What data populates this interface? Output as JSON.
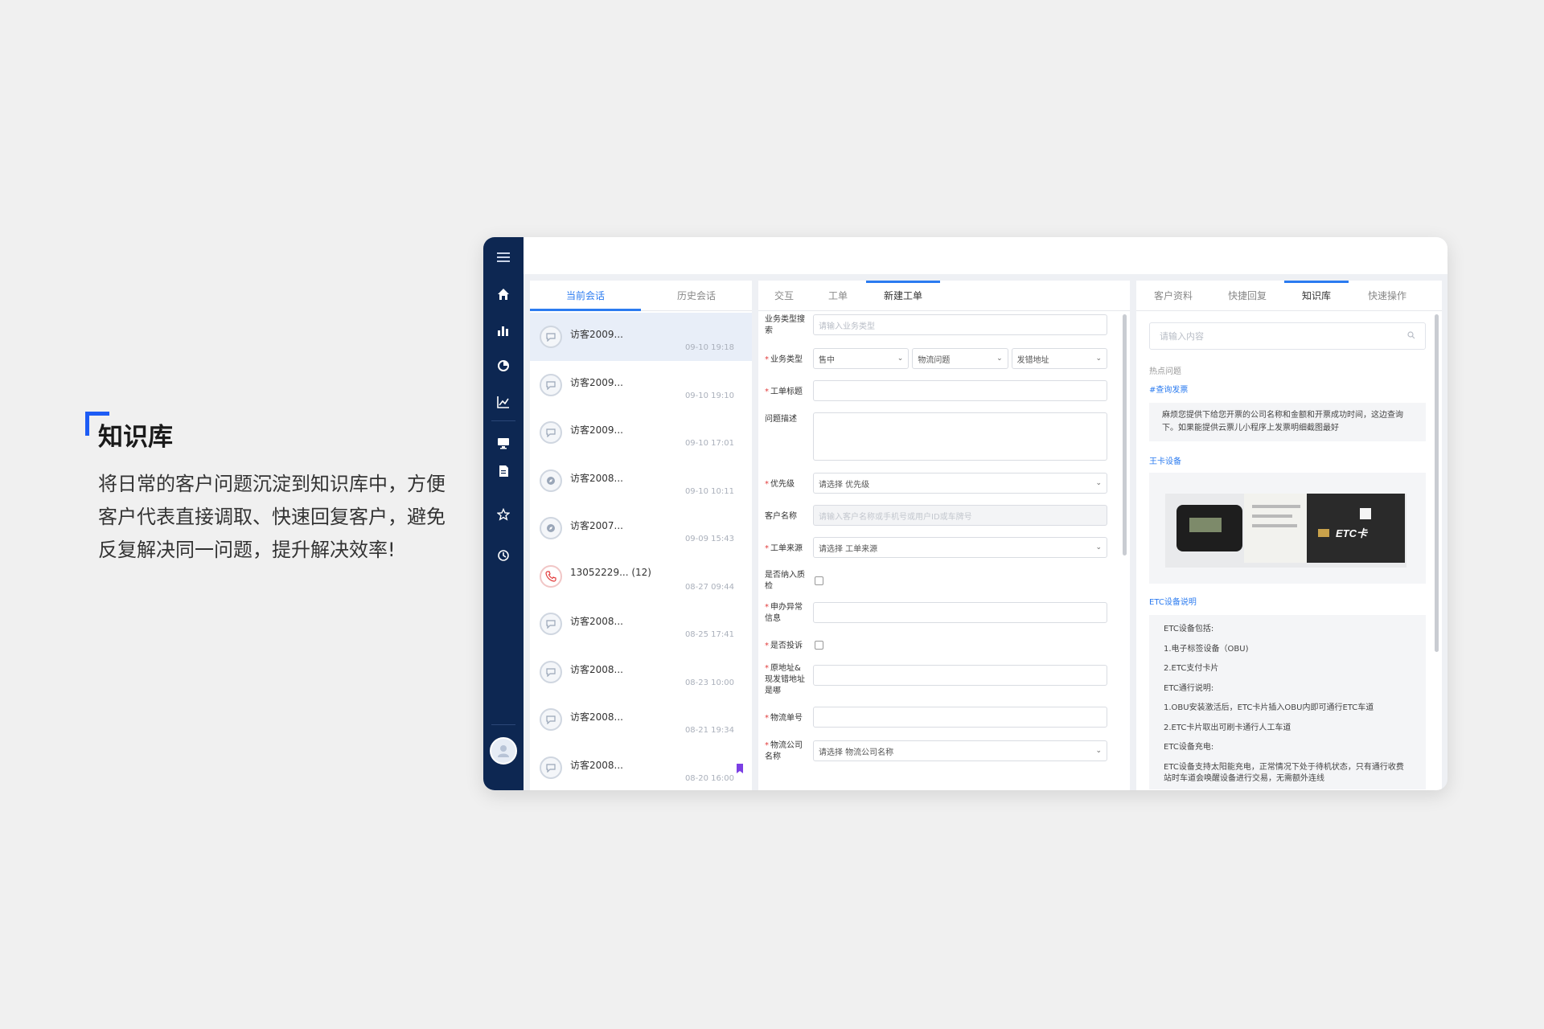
{
  "intro": {
    "title": "知识库",
    "description": "将日常的客户问题沉淀到知识库中，方便客户代表直接调取、快速回复客户，避免反复解决同一问题，提升解决效率!"
  },
  "colors": {
    "accent": "#2b7bf0",
    "rail": "#0d2752",
    "brand_corner": "#1d5cf5",
    "required": "#e23b3b"
  },
  "rail_icons": [
    "menu-icon",
    "home-icon",
    "bar-chart-icon",
    "pie-chart-icon",
    "line-chart-icon",
    "monitor-icon",
    "document-icon",
    "star-icon",
    "history-icon"
  ],
  "conversations": {
    "tabs": [
      "当前会话",
      "历史会话"
    ],
    "items": [
      {
        "name": "访客2009...",
        "time": "09-10 19:18",
        "icon": "chat-icon"
      },
      {
        "name": "访客2009...",
        "time": "09-10 19:10",
        "icon": "chat-icon"
      },
      {
        "name": "访客2009...",
        "time": "09-10 17:01",
        "icon": "chat-icon"
      },
      {
        "name": "访客2008...",
        "time": "09-10 10:11",
        "icon": "compass-icon"
      },
      {
        "name": "访客2007...",
        "time": "09-09 15:43",
        "icon": "compass-icon"
      },
      {
        "name": "13052229...  (12)",
        "time": "08-27 09:44",
        "icon": "phone-icon"
      },
      {
        "name": "访客2008...",
        "time": "08-25 17:41",
        "icon": "chat-icon"
      },
      {
        "name": "访客2008...",
        "time": "08-23 10:00",
        "icon": "chat-icon"
      },
      {
        "name": "访客2008...",
        "time": "08-21 19:34",
        "icon": "chat-icon"
      },
      {
        "name": "访客2008...",
        "time": "08-20 16:00",
        "icon": "chat-icon"
      }
    ]
  },
  "ticket": {
    "tabs": [
      "交互",
      "工单",
      "新建工单"
    ],
    "fields": {
      "biz_search_label": "业务类型搜索",
      "biz_search_placeholder": "请输入业务类型",
      "biz_type_label": "业务类型",
      "biz_type_values": [
        "售中",
        "物流问题",
        "发错地址"
      ],
      "title_label": "工单标题",
      "desc_label": "问题描述",
      "priority_label": "优先级",
      "priority_value": "请选择 优先级",
      "customer_label": "客户名称",
      "customer_placeholder": "请输入客户名称或手机号或用户ID或车牌号",
      "source_label": "工单来源",
      "source_value": "请选择 工单来源",
      "qc_label": "是否纳入质检",
      "exception_label": "申办异常信息",
      "complaint_label": "是否投诉",
      "address_label": "原地址&现发错地址是哪",
      "tracking_label": "物流单号",
      "logistics_label": "物流公司名称",
      "logistics_value": "请选择 物流公司名称"
    }
  },
  "knowledge": {
    "tabs": [
      "客户资料",
      "快捷回复",
      "知识库",
      "快速操作"
    ],
    "search_placeholder": "请输入内容",
    "hot_label": "热点问题",
    "item1_title": "#查询发票",
    "item1_text": "麻烦您提供下给您开票的公司名称和金额和开票成功时间，这边查询下。如果能提供云票儿小程序上发票明细截图最好",
    "item2_title": "王卡设备",
    "card_text": "ETC卡",
    "item3_title": "ETC设备说明",
    "item3_lines": [
      "ETC设备包括:",
      "1.电子标签设备（OBU)",
      "2.ETC支付卡片",
      "ETC通行说明:",
      "1.OBU安装激活后，ETC卡片插入OBU内即可通行ETC车道",
      "2.ETC卡片取出可刷卡通行人工车道",
      "ETC设备充电:",
      "ETC设备支持太阳能充电，正常情况下处于待机状态，只有通行收费站时车道会唤醒设备进行交易，无需额外连线"
    ]
  }
}
